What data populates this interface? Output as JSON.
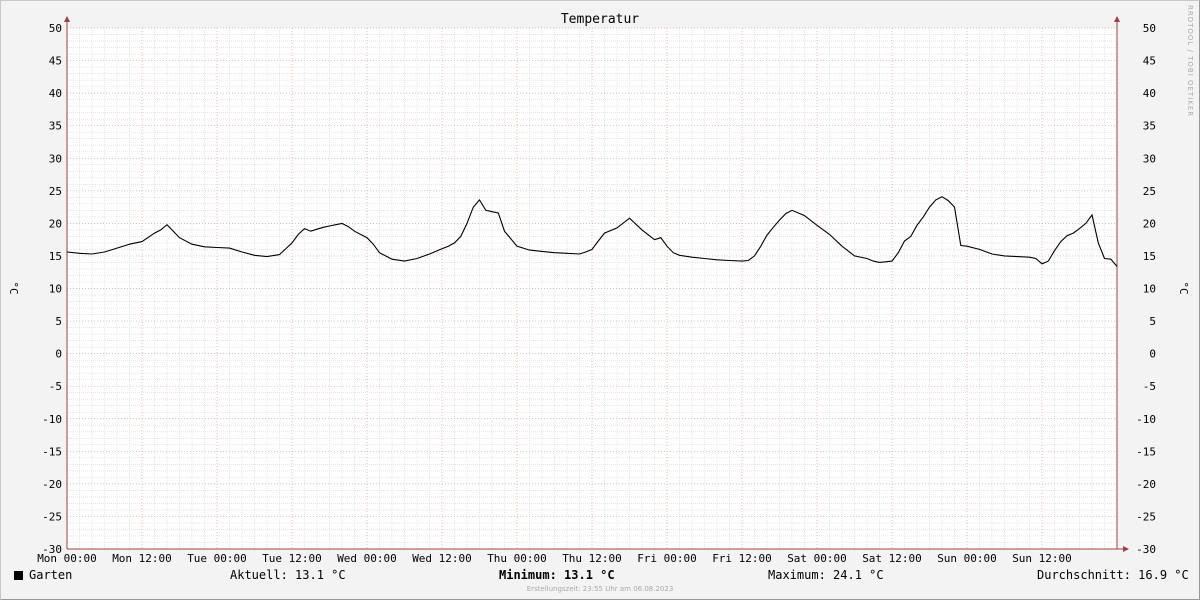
{
  "chart_data": {
    "type": "line",
    "title": "Temperatur",
    "ylabel": "°C",
    "ylim": [
      -30,
      50
    ],
    "y_ticks": [
      50,
      45,
      40,
      35,
      30,
      25,
      20,
      15,
      10,
      5,
      0,
      -5,
      -10,
      -15,
      -20,
      -25,
      -30
    ],
    "x_ticks": [
      "Mon 00:00",
      "Mon 12:00",
      "Tue 00:00",
      "Tue 12:00",
      "Wed 00:00",
      "Wed 12:00",
      "Thu 00:00",
      "Thu 12:00",
      "Fri 00:00",
      "Fri 12:00",
      "Sat 00:00",
      "Sat 12:00",
      "Sun 00:00",
      "Sun 12:00"
    ],
    "x_unit": "hours since Mon 00:00",
    "xlim": [
      0,
      168
    ],
    "grid": true,
    "series": [
      {
        "name": "Garten",
        "color": "#000000",
        "x": [
          0,
          2,
          4,
          6,
          8,
          10,
          12,
          14,
          15,
          16,
          17,
          18,
          20,
          22,
          24,
          26,
          28,
          30,
          32,
          34,
          36,
          37,
          38,
          39,
          40,
          41,
          42,
          43,
          44,
          45,
          46,
          48,
          49,
          50,
          52,
          54,
          56,
          58,
          60,
          61,
          62,
          63,
          64,
          65,
          66,
          67,
          68,
          69,
          70,
          72,
          74,
          76,
          78,
          80,
          82,
          83,
          84,
          85,
          86,
          88,
          90,
          92,
          94,
          95,
          96,
          97,
          98,
          100,
          102,
          104,
          106,
          108,
          109,
          110,
          111,
          112,
          113,
          114,
          115,
          116,
          118,
          120,
          122,
          124,
          126,
          128,
          129,
          130,
          131,
          132,
          133,
          134,
          135,
          136,
          137,
          138,
          139,
          140,
          141,
          142,
          143,
          144,
          146,
          148,
          150,
          152,
          154,
          155,
          156,
          157,
          158,
          159,
          160,
          161,
          162,
          163,
          164,
          165,
          166,
          167,
          168
        ],
        "values": [
          15.6,
          15.4,
          15.3,
          15.6,
          16.2,
          16.8,
          17.2,
          18.5,
          19.0,
          19.8,
          18.8,
          17.8,
          16.8,
          16.4,
          16.3,
          16.2,
          15.6,
          15.1,
          14.9,
          15.2,
          17.0,
          18.3,
          19.2,
          18.8,
          19.1,
          19.4,
          19.6,
          19.8,
          20.0,
          19.5,
          18.8,
          17.8,
          16.8,
          15.5,
          14.5,
          14.2,
          14.6,
          15.3,
          16.1,
          16.5,
          17.0,
          18.0,
          20.0,
          22.5,
          23.6,
          22.0,
          21.8,
          21.6,
          18.8,
          16.5,
          15.9,
          15.7,
          15.5,
          15.4,
          15.3,
          15.6,
          16.0,
          17.3,
          18.5,
          19.3,
          20.8,
          19.0,
          17.5,
          17.8,
          16.5,
          15.5,
          15.1,
          14.8,
          14.6,
          14.4,
          14.3,
          14.2,
          14.3,
          15.0,
          16.5,
          18.2,
          19.4,
          20.5,
          21.5,
          22.0,
          21.2,
          19.7,
          18.3,
          16.5,
          15.0,
          14.6,
          14.2,
          14.0,
          14.1,
          14.2,
          15.5,
          17.3,
          18.0,
          19.7,
          21.0,
          22.5,
          23.6,
          24.1,
          23.5,
          22.5,
          16.6,
          16.5,
          16.0,
          15.3,
          15.0,
          14.9,
          14.8,
          14.6,
          13.8,
          14.2,
          15.8,
          17.2,
          18.1,
          18.5,
          19.2,
          20.0,
          21.3,
          17.0,
          14.6,
          14.5,
          13.4
        ]
      }
    ]
  },
  "legend": {
    "series_name": "Garten",
    "aktuell": "Aktuell: 13.1 °C",
    "minimum": "Minimum: 13.1 °C",
    "maximum": "Maximum: 24.1 °C",
    "durchschnitt": "Durchschnitt: 16.9 °C"
  },
  "footer": "Erstellungszeit: 23:55 Uhr am 06.08.2023",
  "watermark": "RRDTOOL / TOBI OETIKER"
}
